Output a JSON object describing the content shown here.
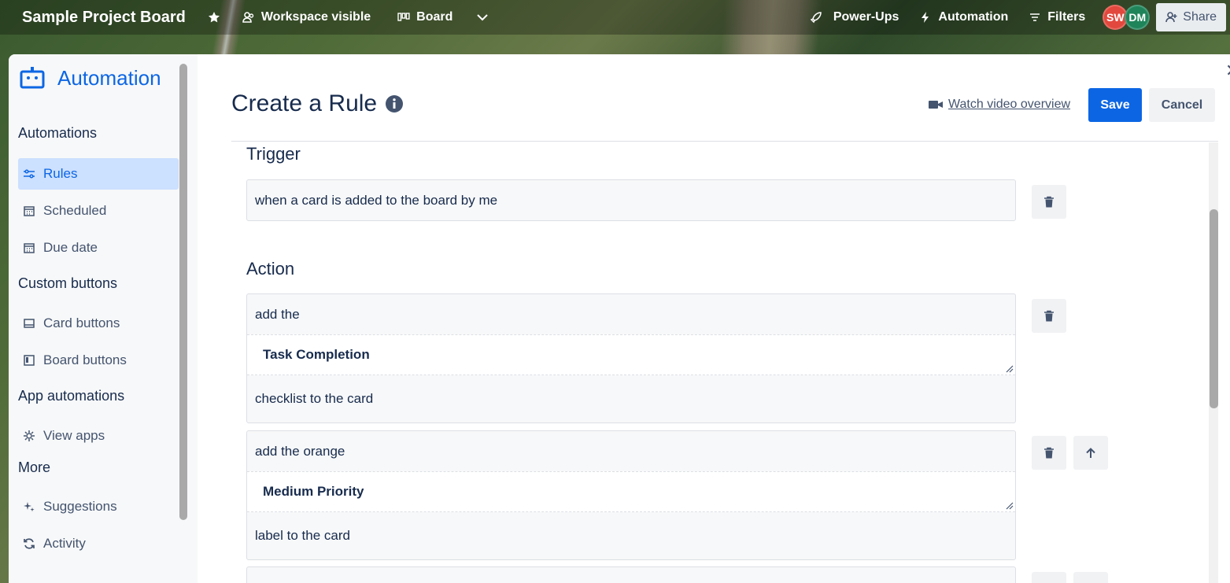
{
  "topbar": {
    "board_title": "Sample Project Board",
    "workspace_visible": "Workspace visible",
    "board_view": "Board",
    "power_ups": "Power-Ups",
    "automation": "Automation",
    "filters": "Filters",
    "avatars": [
      "SW",
      "DM"
    ],
    "share": "Share"
  },
  "sidebar": {
    "title": "Automation",
    "sections": {
      "automations": "Automations",
      "custom_buttons": "Custom buttons",
      "app_automations": "App automations",
      "more": "More"
    },
    "items": {
      "rules": "Rules",
      "scheduled": "Scheduled",
      "due_date": "Due date",
      "card_buttons": "Card buttons",
      "board_buttons": "Board buttons",
      "view_apps": "View apps",
      "suggestions": "Suggestions",
      "activity": "Activity"
    },
    "active_item": "rules"
  },
  "main": {
    "page_title": "Create a Rule",
    "watch_video": "Watch video overview",
    "save": "Save",
    "cancel": "Cancel",
    "trigger_heading": "Trigger",
    "trigger_text": "when a card is added to the board by me",
    "action_heading": "Action",
    "actions": [
      {
        "prefix": "add the",
        "field": "Task Completion",
        "suffix": "checklist to the card"
      },
      {
        "prefix": "add the orange",
        "field": "Medium Priority",
        "suffix": "label to the card"
      }
    ]
  },
  "colors": {
    "accent": "#0c66e4",
    "sidebar_active_bg": "#cce0ff",
    "avatar_sw": "#e2483d",
    "avatar_dm": "#1f845a"
  }
}
